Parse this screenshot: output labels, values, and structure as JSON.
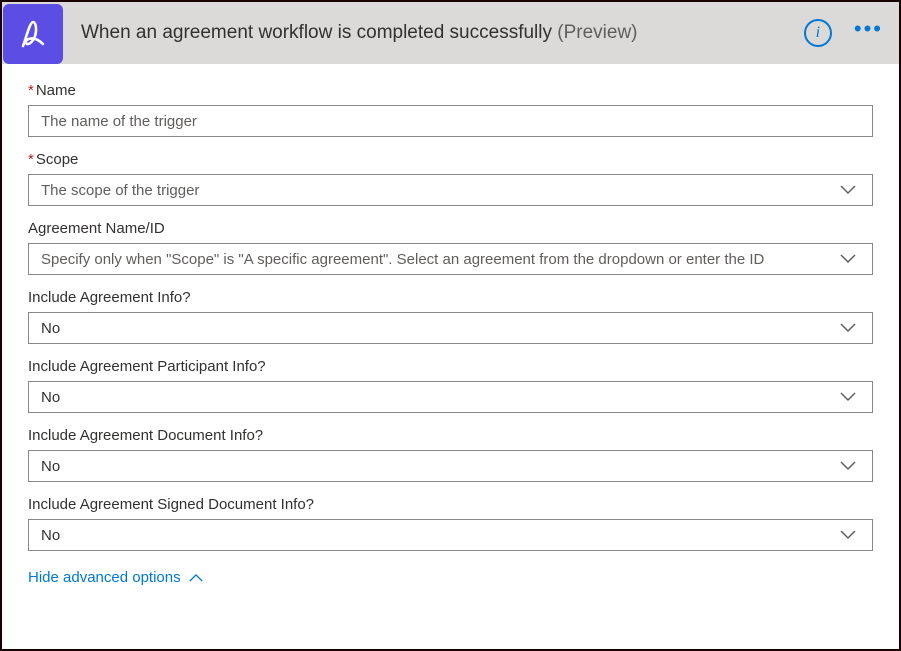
{
  "header": {
    "title": "When an agreement workflow is completed successfully",
    "preview": "(Preview)"
  },
  "fields": {
    "name": {
      "label": "Name",
      "required": true,
      "placeholder": "The name of the trigger"
    },
    "scope": {
      "label": "Scope",
      "required": true,
      "placeholder": "The scope of the trigger"
    },
    "agreementId": {
      "label": "Agreement Name/ID",
      "required": false,
      "placeholder": "Specify only when \"Scope\" is \"A specific agreement\". Select an agreement from the dropdown or enter the ID"
    },
    "includeInfo": {
      "label": "Include Agreement Info?",
      "required": false,
      "value": "No"
    },
    "includeParticipant": {
      "label": "Include Agreement Participant Info?",
      "required": false,
      "value": "No"
    },
    "includeDocument": {
      "label": "Include Agreement Document Info?",
      "required": false,
      "value": "No"
    },
    "includeSigned": {
      "label": "Include Agreement Signed Document Info?",
      "required": false,
      "value": "No"
    }
  },
  "advancedLink": "Hide advanced options"
}
